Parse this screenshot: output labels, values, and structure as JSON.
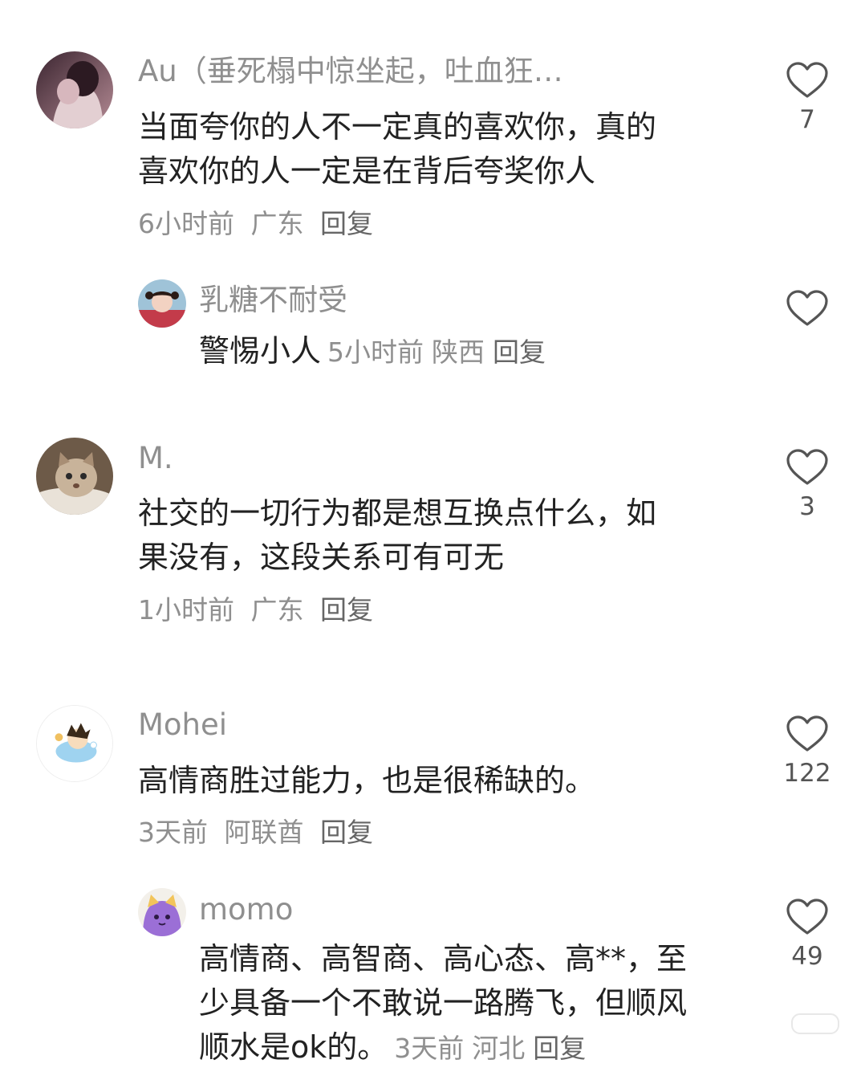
{
  "comments": [
    {
      "username": "Au（垂死榻中惊坐起，吐血狂…",
      "text_line1": "当面夸你的人不一定真的喜欢你，真的",
      "text_line2": "喜欢你的人一定是在背后夸奖你人",
      "time": "6小时前",
      "location": "广东",
      "reply_label": "回复",
      "likes": "7",
      "avatar": "dark-illustrated-avatar",
      "replies": [
        {
          "username": "乳糖不耐受",
          "text": "警惕小人",
          "time": "5小时前",
          "location": "陕西",
          "reply_label": "回复",
          "likes": "",
          "avatar": "girl-photo-avatar"
        }
      ]
    },
    {
      "username": "M.",
      "text_line1": "社交的一切行为都是想互换点什么，如",
      "text_line2": "果没有，这段关系可有可无",
      "time": "1小时前",
      "location": "广东",
      "reply_label": "回复",
      "likes": "3",
      "avatar": "cat-photo-avatar",
      "replies": []
    },
    {
      "username": "Mohei",
      "text_line1": "高情商胜过能力，也是很稀缺的。",
      "time": "3天前",
      "location": "阿联酋",
      "reply_label": "回复",
      "likes": "122",
      "avatar": "cartoon-bath-avatar",
      "replies": [
        {
          "username": "momo",
          "text_line1": "高情商、高智商、高心态、高**，至",
          "text_line2": "少具备一个不敢说一路腾飞，但顺风",
          "text_line3": "顺水是ok的。",
          "time": "3天前",
          "location": "河北",
          "reply_label": "回复",
          "likes": "49",
          "avatar": "purple-cat-avatar"
        }
      ]
    }
  ],
  "icons": {
    "like": "heart-outline-icon"
  },
  "colors": {
    "username": "#8f8f8f",
    "text": "#222222",
    "meta": "#8f8f8f",
    "heart_stroke": "#555555",
    "background": "#ffffff"
  }
}
